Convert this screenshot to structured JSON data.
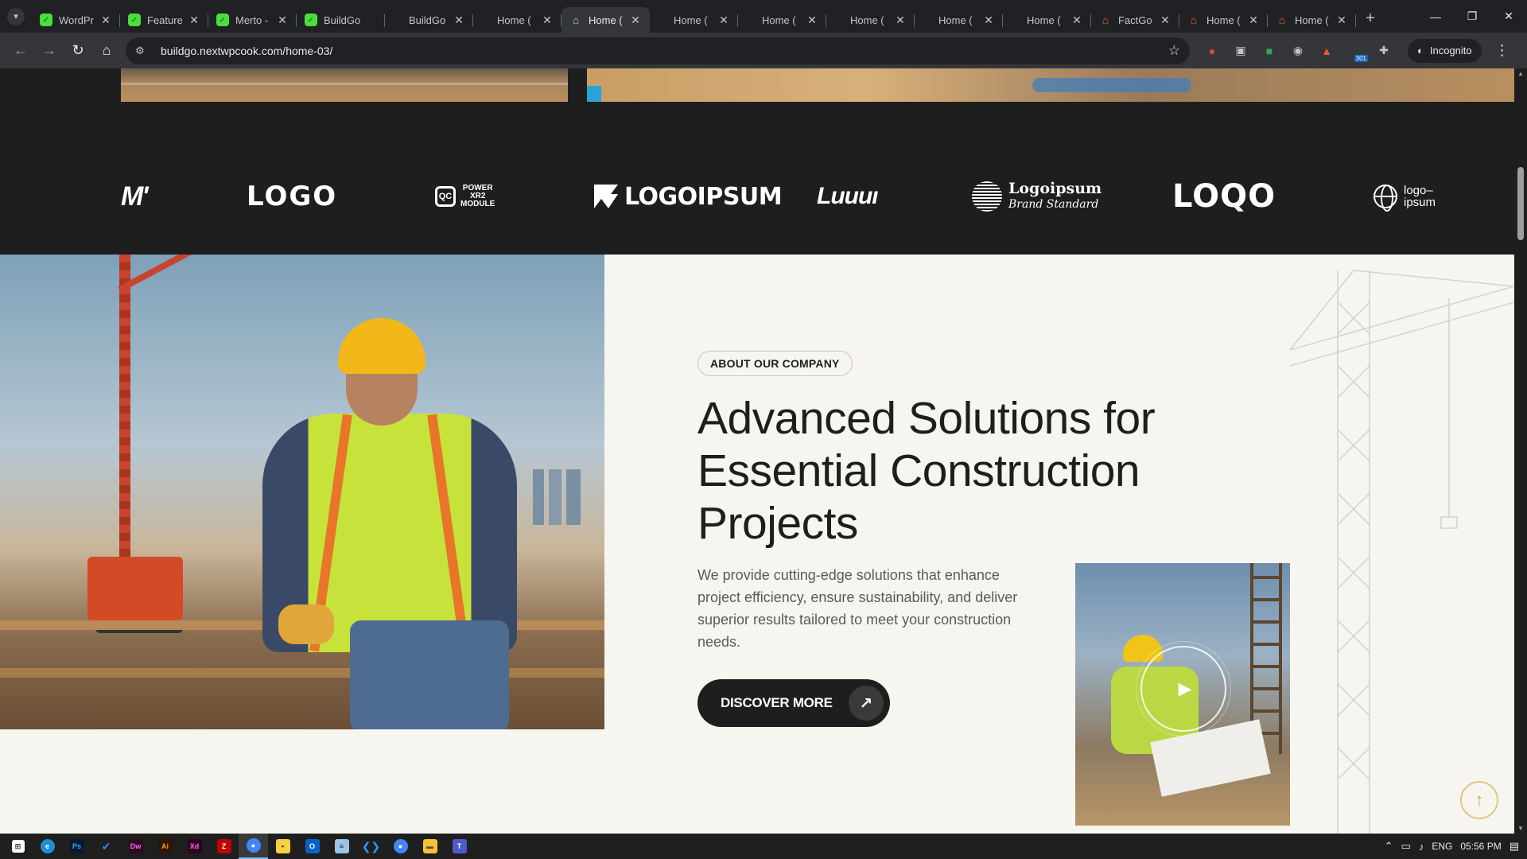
{
  "browser": {
    "tabs": [
      {
        "title": "WordPr",
        "favicon": "green-leaf-icon",
        "active": false
      },
      {
        "title": "Feature",
        "favicon": "green-leaf-icon",
        "active": false
      },
      {
        "title": "Merto -",
        "favicon": "green-leaf-icon",
        "active": false
      },
      {
        "title": "BuildGo",
        "favicon": "green-leaf-icon",
        "active": false
      },
      {
        "title": "BuildGo",
        "favicon": "none",
        "active": false
      },
      {
        "title": "Home (",
        "favicon": "none",
        "active": false
      },
      {
        "title": "Home (",
        "favicon": "home-icon",
        "active": true
      },
      {
        "title": "Home (",
        "favicon": "none",
        "active": false
      },
      {
        "title": "Home (",
        "favicon": "none",
        "active": false
      },
      {
        "title": "Home (",
        "favicon": "none",
        "active": false
      },
      {
        "title": "Home (",
        "favicon": "none",
        "active": false
      },
      {
        "title": "Home (",
        "favicon": "none",
        "active": false
      },
      {
        "title": "FactGo",
        "favicon": "orange-factory-icon",
        "active": false
      },
      {
        "title": "Home (",
        "favicon": "orange-factory-icon",
        "active": false
      },
      {
        "title": "Home (",
        "favicon": "orange-factory-icon",
        "active": false
      }
    ],
    "url": "buildgo.nextwpcook.com/home-03/",
    "incognito_label": "Incognito",
    "extension_badge": "301"
  },
  "page": {
    "partner_logos": [
      "M",
      "LOGO",
      "POWER XR2 MODULE",
      "LOGOIPSUM",
      "Luum",
      "Logoipsum Brand Standard",
      "LOQO",
      "logo-ipsum"
    ],
    "logo_texts": {
      "m": "M'",
      "logo": "LOGO",
      "qc_box": "QC",
      "qc_line1": "POWER",
      "qc_line2": "XR2",
      "qc_line3": "MODULE",
      "logoipsum": "LOGOIPSUM",
      "script": "Luuuı",
      "brand_name": "Logoipsum",
      "brand_tag": "Brand Standard",
      "loqo": "LOQO",
      "globe_line1": "logo–",
      "globe_line2": "ipsum"
    },
    "about": {
      "label": "ABOUT OUR COMPANY",
      "heading": "Advanced Solutions for Essential Construction Projects",
      "description": "We provide cutting-edge solutions that enhance project efficiency, ensure sustainability, and deliver superior results tailored to meet your construction needs.",
      "button_label": "DISCOVER MORE"
    }
  },
  "taskbar": {
    "apps": [
      "windows-start",
      "edge",
      "photoshop",
      "todo",
      "dreamweaver",
      "illustrator",
      "xd",
      "filezilla",
      "chrome-active",
      "sticky-notes",
      "outlook",
      "notepad",
      "vscode",
      "chrome",
      "file-explorer",
      "teams"
    ],
    "language": "ENG",
    "time": "05:56 PM"
  },
  "colors": {
    "page_bg": "#f7f5ef",
    "dark": "#1e1e1e",
    "accent_gold": "#d4a64a"
  }
}
